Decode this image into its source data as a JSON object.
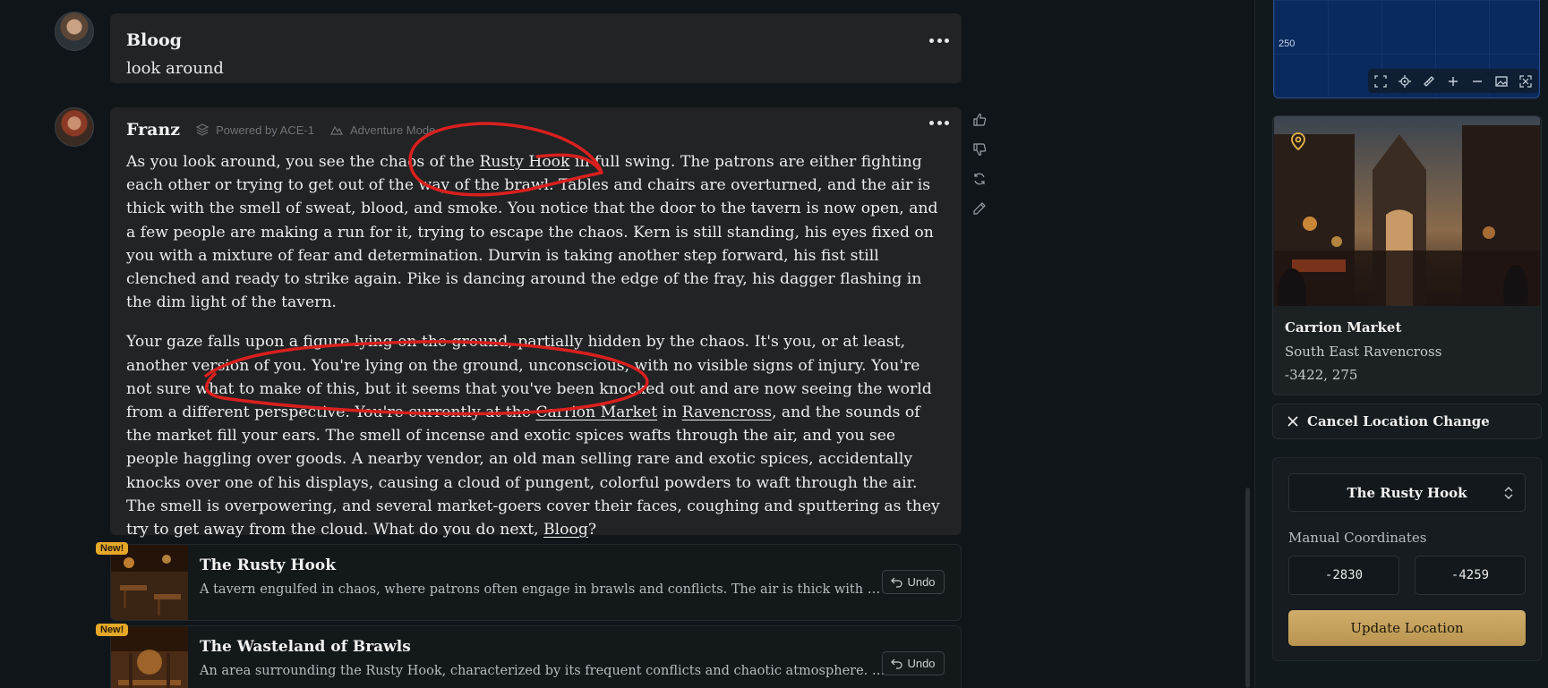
{
  "messages": [
    {
      "author": "Bloog",
      "text": "look around"
    },
    {
      "author": "Franz",
      "powered_by": "Powered by ACE-1",
      "mode": "Adventure Mode",
      "p1": [
        "As you look around, you see the chaos of the ",
        "Rusty Hook",
        " in full swing. The patrons are either fighting each other or trying to get out of the way of the brawl. Tables and chairs are overturned, and the air is thick with the smell of sweat, blood, and smoke. You notice that the door to the tavern is now open, and a few people are making a run for it, trying to escape the chaos. Kern is still standing, his eyes fixed on you with a mixture of fear and determination. Durvin is taking another step forward, his fist still clenched and ready to strike again. Pike is dancing around the edge of the fray, his dagger flashing in the dim light of the tavern."
      ],
      "p2": [
        "Your gaze falls upon a figure lying on the ground, partially hidden by the chaos. It's you, or at least, another version of you. You're lying on the ground, unconscious, with no visible signs of injury. You're not sure what to make of this, but it seems that you've been knocked out and are now seeing the world from a different perspective. You're currently at the ",
        "Carrion Market",
        " in ",
        "Ravencross",
        ", and the sounds of the market fill your ears. The smell of incense and exotic spices wafts through the air, and you see people haggling over goods. A nearby vendor, an old man selling rare and exotic spices, accidentally knocks over one of his displays, causing a cloud of pungent, colorful powders to waft through the air. The smell is overpowering, and several market-goers cover their faces, coughing and sputtering as they try to get away from the cloud. What do you do next, ",
        "Bloog",
        "?"
      ]
    }
  ],
  "new_locations": [
    {
      "badge": "New!",
      "title": "The Rusty Hook",
      "desc": "A tavern engulfed in chaos, where patrons often engage in brawls and conflicts. The air is thick with …",
      "undo": "Undo"
    },
    {
      "badge": "New!",
      "title": "The Wasteland of Brawls",
      "desc": "An area surrounding the Rusty Hook, characterized by its frequent conflicts and chaotic atmosphere. …",
      "undo": "Undo"
    }
  ],
  "map": {
    "axis_label": "250"
  },
  "location": {
    "name": "Carrion Market",
    "region": "South East Ravencross",
    "coords": "-3422, 275"
  },
  "cancel_label": "Cancel Location Change",
  "form": {
    "selected": "The Rusty Hook",
    "manual_label": "Manual Coordinates",
    "x": "-2830",
    "y": "-4259",
    "update_label": "Update Location"
  },
  "colors": {
    "accent_gold": "#c9a862",
    "badge": "#e6a828",
    "map_bg": "#0a2a5e",
    "scribble": "#d9201e"
  }
}
